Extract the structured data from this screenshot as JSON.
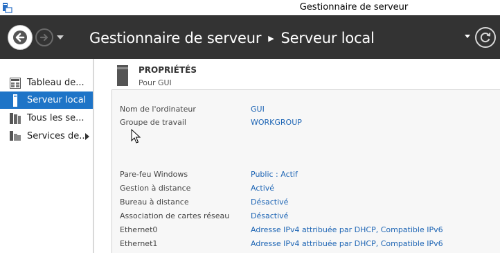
{
  "window": {
    "title": "Gestionnaire de serveur"
  },
  "header": {
    "breadcrumb": [
      "Gestionnaire de serveur",
      "Serveur local"
    ]
  },
  "sidebar": {
    "items": [
      {
        "label": "Tableau de...",
        "icon": "dashboard-icon",
        "active": false
      },
      {
        "label": "Serveur local",
        "icon": "server-icon",
        "active": true
      },
      {
        "label": "Tous les se...",
        "icon": "servers-icon",
        "active": false
      },
      {
        "label": "Services de...",
        "icon": "file-services-icon",
        "active": false
      }
    ]
  },
  "properties": {
    "title": "PROPRIÉTÉS",
    "subtitle": "Pour GUI",
    "rows": [
      {
        "label": "Nom de l'ordinateur",
        "value": "GUI"
      },
      {
        "label": "Groupe de travail",
        "value": "WORKGROUP"
      },
      {
        "label": "Pare-feu Windows",
        "value": "Public : Actif"
      },
      {
        "label": "Gestion à distance",
        "value": "Activé"
      },
      {
        "label": "Bureau à distance",
        "value": "Désactivé"
      },
      {
        "label": "Association de cartes réseau",
        "value": "Désactivé"
      },
      {
        "label": "Ethernet0",
        "value": "Adresse IPv4 attribuée par DHCP, Compatible IPv6"
      },
      {
        "label": "Ethernet1",
        "value": "Adresse IPv4 attribuée par DHCP, Compatible IPv6"
      }
    ]
  },
  "colors": {
    "header_bg": "#333333",
    "active_item": "#1e74c7",
    "link": "#1c64b4"
  }
}
